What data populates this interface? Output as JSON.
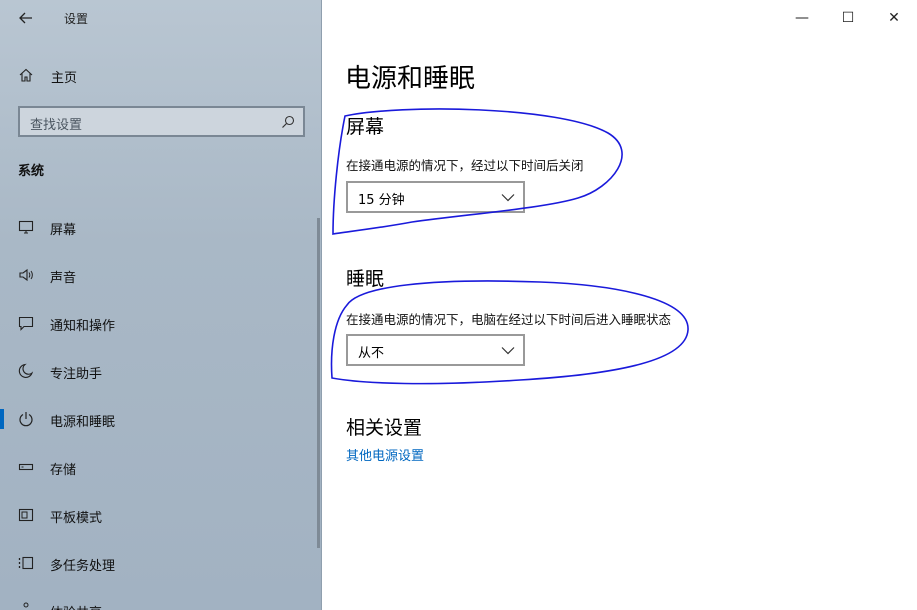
{
  "window": {
    "title": "设置",
    "controls": {
      "minimize": "—",
      "maximize": "☐",
      "close": "✕"
    }
  },
  "sidebar": {
    "home_label": "主页",
    "search_placeholder": "查找设置",
    "section": "系统",
    "items": [
      {
        "label": "屏幕",
        "icon": "monitor-icon"
      },
      {
        "label": "声音",
        "icon": "speaker-icon"
      },
      {
        "label": "通知和操作",
        "icon": "notification-icon"
      },
      {
        "label": "专注助手",
        "icon": "moon-icon"
      },
      {
        "label": "电源和睡眠",
        "icon": "power-icon",
        "active": true
      },
      {
        "label": "存储",
        "icon": "storage-icon"
      },
      {
        "label": "平板模式",
        "icon": "tablet-icon"
      },
      {
        "label": "多任务处理",
        "icon": "multitask-icon"
      },
      {
        "label": "体验共享",
        "icon": "share-icon"
      }
    ]
  },
  "main": {
    "title": "电源和睡眠",
    "screen": {
      "heading": "屏幕",
      "description": "在接通电源的情况下，经过以下时间后关闭",
      "value": "15 分钟"
    },
    "sleep": {
      "heading": "睡眠",
      "description": "在接通电源的情况下，电脑在经过以下时间后进入睡眠状态",
      "value": "从不"
    },
    "related": {
      "heading": "相关设置",
      "link": "其他电源设置"
    }
  },
  "colors": {
    "accent": "#0067c0",
    "annotation": "#1a1adb",
    "sidebar_bg": "#a9b8c6"
  }
}
